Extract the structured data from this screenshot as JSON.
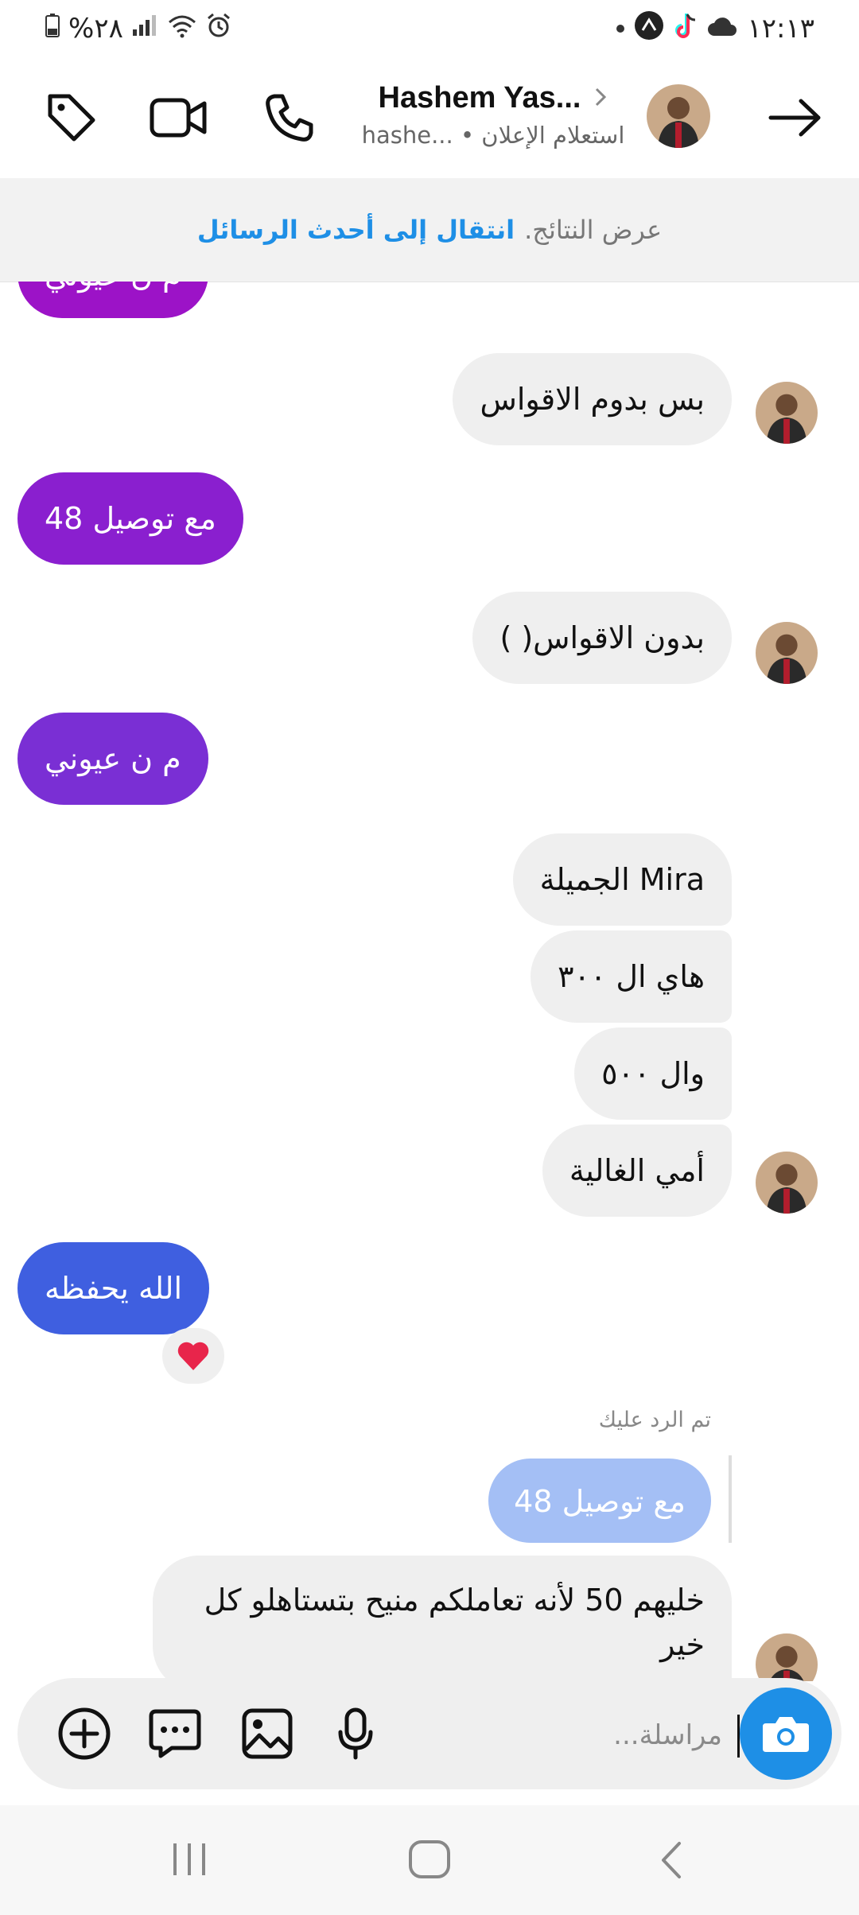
{
  "status_bar": {
    "battery": "%٢٨",
    "time": "١٢:١٣"
  },
  "header": {
    "name": "Hashem Yas...",
    "subtitle": "hashe... • استعلام الإعلان"
  },
  "banner": {
    "label": "عرض النتائج.",
    "link": "انتقال إلى أحدث الرسائل"
  },
  "messages": [
    {
      "text": "م ن عيوني",
      "side": "out",
      "color": "#9c13c7"
    },
    {
      "text": "بس بدوم الاقواس",
      "side": "in"
    },
    {
      "text": "مع توصيل 48",
      "side": "out",
      "color": "#8a1fcf"
    },
    {
      "text": "بدون الاقواس( )",
      "side": "in"
    },
    {
      "text": "م ن عيوني",
      "side": "out",
      "color": "#7a2fd4"
    },
    {
      "text": "Mira الجميلة",
      "side": "in"
    },
    {
      "text": "هاي ال ٣٠٠",
      "side": "in"
    },
    {
      "text": "وال ٥٠٠",
      "side": "in"
    },
    {
      "text": "أمي الغالية",
      "side": "in"
    },
    {
      "text": "الله يحفظه",
      "side": "out",
      "color": "#3f5fe0"
    }
  ],
  "reaction": {
    "emoji": "heart-icon",
    "color": "#e8254b"
  },
  "reply": {
    "label": "تم الرد عليك",
    "quoted": "مع توصيل 48",
    "quoted_color": "#a4bff5",
    "text_line1": "خليهم 50 لأنه تعاملكم منيح بتستاهلو كل",
    "text_line2": "خير"
  },
  "composer": {
    "placeholder": "مراسلة...",
    "accent": "#1e8fe6"
  }
}
